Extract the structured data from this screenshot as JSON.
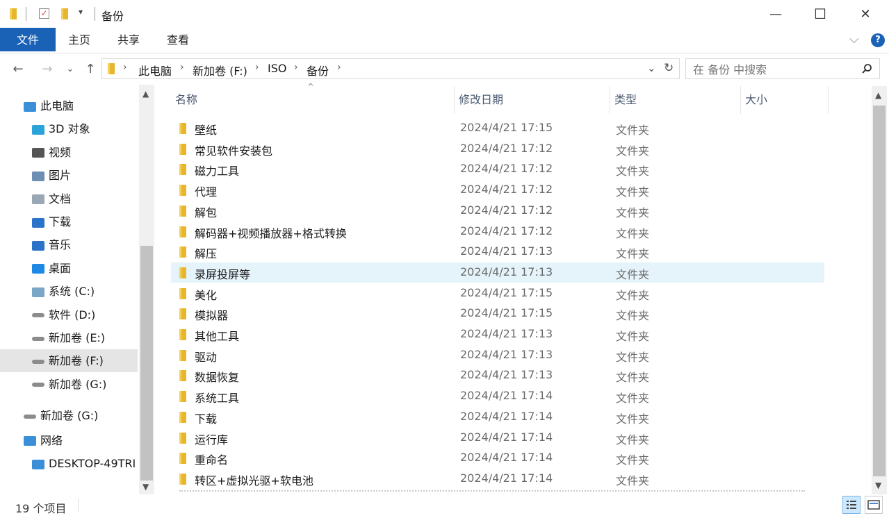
{
  "window": {
    "title": "备份"
  },
  "titlebar": {
    "dropdown_glyph": "▾",
    "minimize": "—",
    "maximize": "☐",
    "close": "✕"
  },
  "ribbon": {
    "tabs": [
      "文件",
      "主页",
      "共享",
      "查看"
    ],
    "help": "?",
    "expand": "⌵"
  },
  "nav": {
    "back": "←",
    "forward": "→",
    "recent": "⌄",
    "up": "↑"
  },
  "address": {
    "crumbs": [
      "此电脑",
      "新加卷 (F:)",
      "ISO",
      "备份"
    ],
    "separator": "›",
    "dropdown": "⌄",
    "refresh": "↻"
  },
  "search": {
    "placeholder": "在 备份 中搜索",
    "icon": "search-icon"
  },
  "navpane": {
    "items": [
      {
        "label": "此电脑",
        "icon": "pc-icon",
        "indent": 0
      },
      {
        "label": "3D 对象",
        "icon": "3d-objects-icon",
        "indent": 1
      },
      {
        "label": "视频",
        "icon": "video-icon",
        "indent": 1
      },
      {
        "label": "图片",
        "icon": "pictures-icon",
        "indent": 1
      },
      {
        "label": "文档",
        "icon": "documents-icon",
        "indent": 1
      },
      {
        "label": "下载",
        "icon": "download-icon",
        "indent": 1
      },
      {
        "label": "音乐",
        "icon": "music-icon",
        "indent": 1
      },
      {
        "label": "桌面",
        "icon": "desktop-icon",
        "indent": 1
      },
      {
        "label": "系统 (C:)",
        "icon": "system-drive-icon",
        "indent": 1
      },
      {
        "label": "软件 (D:)",
        "icon": "drive-icon",
        "indent": 1
      },
      {
        "label": "新加卷 (E:)",
        "icon": "drive-icon",
        "indent": 1
      },
      {
        "label": "新加卷 (F:)",
        "icon": "drive-icon",
        "indent": 1,
        "selected": true
      },
      {
        "label": "新加卷 (G:)",
        "icon": "drive-icon",
        "indent": 1
      },
      {
        "label": "新加卷 (G:)",
        "icon": "drive-icon",
        "indent": 0
      },
      {
        "label": "网络",
        "icon": "network-icon",
        "indent": 0
      },
      {
        "label": "DESKTOP-49TRI",
        "icon": "computer-icon",
        "indent": 1
      }
    ]
  },
  "columns": {
    "name": "名称",
    "date": "修改日期",
    "type": "类型",
    "size": "大小",
    "sort_glyph": "^"
  },
  "files": [
    {
      "name": "壁纸",
      "date": "2024/4/21 17:15",
      "type": "文件夹"
    },
    {
      "name": "常见软件安装包",
      "date": "2024/4/21 17:12",
      "type": "文件夹"
    },
    {
      "name": "磁力工具",
      "date": "2024/4/21 17:12",
      "type": "文件夹"
    },
    {
      "name": "代理",
      "date": "2024/4/21 17:12",
      "type": "文件夹"
    },
    {
      "name": "解包",
      "date": "2024/4/21 17:12",
      "type": "文件夹"
    },
    {
      "name": "解码器+视频播放器+格式转换",
      "date": "2024/4/21 17:12",
      "type": "文件夹"
    },
    {
      "name": "解压",
      "date": "2024/4/21 17:13",
      "type": "文件夹"
    },
    {
      "name": "录屏投屏等",
      "date": "2024/4/21 17:13",
      "type": "文件夹",
      "selected": true
    },
    {
      "name": "美化",
      "date": "2024/4/21 17:15",
      "type": "文件夹"
    },
    {
      "name": "模拟器",
      "date": "2024/4/21 17:15",
      "type": "文件夹"
    },
    {
      "name": "其他工具",
      "date": "2024/4/21 17:13",
      "type": "文件夹"
    },
    {
      "name": "驱动",
      "date": "2024/4/21 17:13",
      "type": "文件夹"
    },
    {
      "name": "数据恢复",
      "date": "2024/4/21 17:13",
      "type": "文件夹"
    },
    {
      "name": "系统工具",
      "date": "2024/4/21 17:14",
      "type": "文件夹"
    },
    {
      "name": "下载",
      "date": "2024/4/21 17:14",
      "type": "文件夹"
    },
    {
      "name": "运行库",
      "date": "2024/4/21 17:14",
      "type": "文件夹"
    },
    {
      "name": "重命名",
      "date": "2024/4/21 17:14",
      "type": "文件夹"
    },
    {
      "name": "转区+虚拟光驱+软电池",
      "date": "2024/4/21 17:14",
      "type": "文件夹"
    }
  ],
  "status": {
    "count": "19 个项目"
  },
  "colors": {
    "accent": "#1a62b5",
    "selected_row": "#e5f3fb",
    "folder": "#e8b62d"
  }
}
